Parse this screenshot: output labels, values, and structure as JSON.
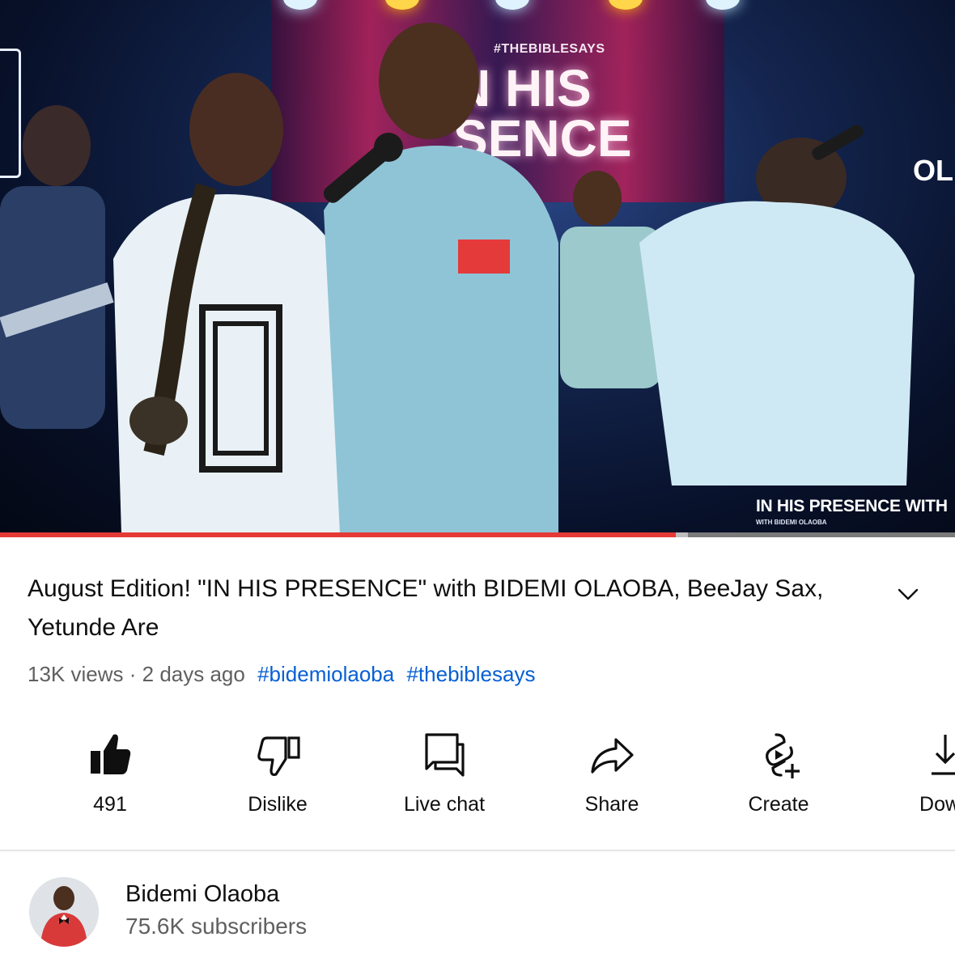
{
  "video": {
    "screen_tag": "#THEBIBLESAYS",
    "screen_title_line1": "N HIS",
    "screen_title_line2": "SENCE",
    "side_text": "OL",
    "caption": "IN HIS PRESENCE WITH",
    "subcaption": "WITH BIDEMI OLAOBA",
    "progress_fraction": 0.708,
    "buffered_fraction": 0.72
  },
  "title": "August Edition! \"IN HIS PRESENCE\"  with BIDEMI OLAOBA, BeeJay Sax, Yetunde Are",
  "meta": {
    "views": "13K views",
    "separator": "·",
    "age": "2 days ago",
    "hashtags": [
      "#bidemiolaoba",
      "#thebiblesays"
    ]
  },
  "actions": [
    {
      "icon": "thumbs-up-filled-icon",
      "label": "491"
    },
    {
      "icon": "thumbs-down-icon",
      "label": "Dislike"
    },
    {
      "icon": "live-chat-icon",
      "label": "Live chat"
    },
    {
      "icon": "share-icon",
      "label": "Share"
    },
    {
      "icon": "create-icon",
      "label": "Create"
    },
    {
      "icon": "download-icon",
      "label": "Down"
    }
  ],
  "channel": {
    "name": "Bidemi Olaoba",
    "subscribers": "75.6K subscribers"
  },
  "colors": {
    "progress": "#e53935",
    "hashtag": "#065fd4",
    "secondary_text": "#606060"
  }
}
